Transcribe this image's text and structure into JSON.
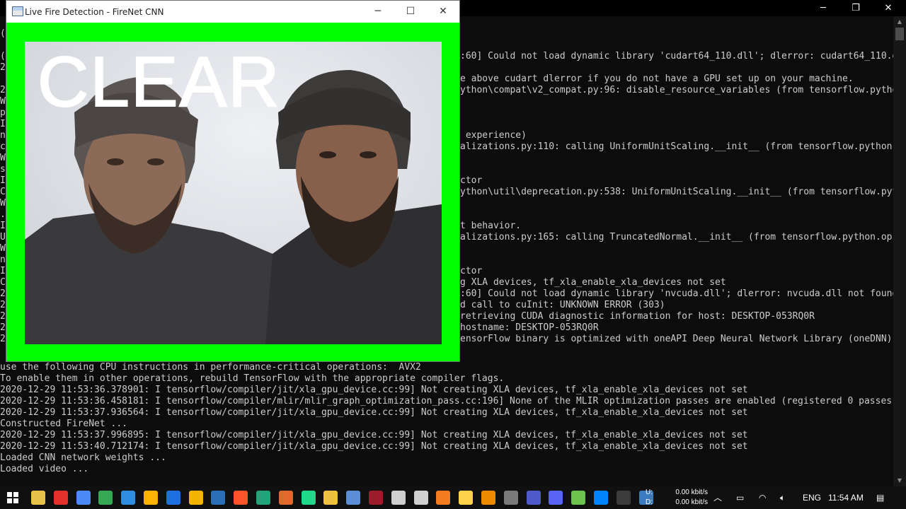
{
  "console": {
    "caption": {
      "minimize": "─",
      "maximize": "❐",
      "close": "✕"
    },
    "hidden_left_chars": [
      "(",
      "",
      "(",
      "2",
      "",
      "2",
      "W",
      "p",
      "I",
      "n",
      "c",
      "W",
      "s",
      "I",
      "C",
      "W",
      ".",
      "I",
      "U",
      "W",
      "n",
      "I",
      "C",
      "2",
      "2",
      "2",
      "2",
      "2"
    ],
    "right_fragments": [
      ":60] Could not load dynamic library 'cudart64_110.dll'; dlerror: cudart64_110.dll",
      "",
      "e above cudart dlerror if you do not have a GPU set up on your machine.",
      "ython\\compat\\v2_compat.py:96: disable_resource_variables (from tensorflow.python.o",
      "",
      "",
      "",
      " experience)",
      "alizations.py:110: calling UniformUnitScaling.__init__ (from tensorflow.python.op",
      "",
      "",
      "ctor",
      "ython\\util\\deprecation.py:538: UniformUnitScaling.__init__ (from tensorflow.python",
      "",
      "",
      "t behavior.",
      "alizations.py:165: calling TruncatedNormal.__init__ (from tensorflow.python.ops.i",
      "",
      "",
      "ctor",
      "g XLA devices, tf_xla_enable_xla_devices not set",
      ":60] Could not load dynamic library 'nvcuda.dll'; dlerror: nvcuda.dll not found",
      "d call to cuInit: UNKNOWN ERROR (303)",
      "retrieving CUDA diagnostic information for host: DESKTOP-053RQ0R",
      "hostname: DESKTOP-053RQ0R",
      "ensorFlow binary is optimized with oneAPI Deep Neural Network Library (oneDNN) to"
    ],
    "partial_line": "use the following CPU instructions in performance-critical operations:  AVX2",
    "full_lines": [
      "To enable them in other operations, rebuild TensorFlow with the appropriate compiler flags.",
      "2020-12-29 11:53:36.378901: I tensorflow/compiler/jit/xla_gpu_device.cc:99] Not creating XLA devices, tf_xla_enable_xla_devices not set",
      "2020-12-29 11:53:36.458181: I tensorflow/compiler/mlir/mlir_graph_optimization_pass.cc:196] None of the MLIR optimization passes are enabled (registered 0 passes)",
      "2020-12-29 11:53:37.936564: I tensorflow/compiler/jit/xla_gpu_device.cc:99] Not creating XLA devices, tf_xla_enable_xla_devices not set",
      "Constructed FireNet ...",
      "2020-12-29 11:53:37.996895: I tensorflow/compiler/jit/xla_gpu_device.cc:99] Not creating XLA devices, tf_xla_enable_xla_devices not set",
      "2020-12-29 11:53:40.712174: I tensorflow/compiler/jit/xla_gpu_device.cc:99] Not creating XLA devices, tf_xla_enable_xla_devices not set",
      "Loaded CNN network weights ...",
      "Loaded video ..."
    ]
  },
  "cv_window": {
    "title": "Live Fire Detection - FireNet CNN",
    "caption": {
      "minimize": "─",
      "maximize": "☐",
      "close": "✕"
    },
    "status_text": "CLEAR",
    "border_color": "#00ff00"
  },
  "taskbar": {
    "icons": [
      "file-explorer-icon",
      "opera-icon",
      "chrome-icon",
      "chrome-alt-icon",
      "edge-icon",
      "paint-icon",
      "teamviewer-icon",
      "chrome-canary-icon",
      "hex-editor-icon",
      "brave-icon",
      "edge-dev-icon",
      "matlab-icon",
      "pycharm-icon",
      "folder-icon",
      "box-icon",
      "mendeley-icon",
      "media-prev-icon",
      "process-icon",
      "xampp-icon",
      "sticky-notes-icon",
      "vlc-icon",
      "app-icon",
      "teams-icon",
      "discord-icon",
      "chat-icon",
      "messenger-icon",
      "terminal-icon",
      "python-icon"
    ],
    "network": {
      "up_label": "U:",
      "down_label": "D:",
      "up_value": "0.00 kbit/s",
      "down_value": "0.00 kbit/s"
    },
    "language": "ENG",
    "time": "11:54 AM"
  }
}
